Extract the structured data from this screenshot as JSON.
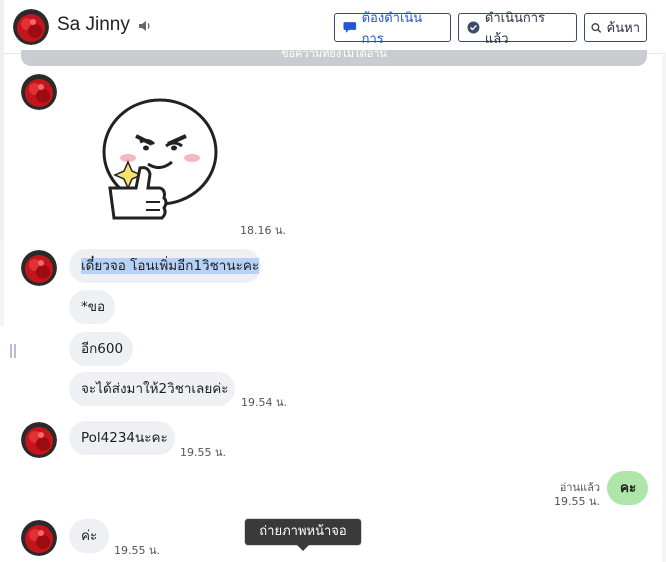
{
  "header": {
    "contact_name": "Sa Jinny",
    "buttons": {
      "todo_label": "ต้องดำเนินการ",
      "done_label": "ดำเนินการแล้ว",
      "search_label": "ค้นหา"
    }
  },
  "unread_banner": "ข้อความที่ยังไม่ได้อ่าน",
  "messages": [
    {
      "type": "sticker",
      "time": "18.16 น."
    },
    {
      "text_highlighted": "เดี๋ยวจอ โอนเพิ่มอีก1วิชานะคะ"
    },
    {
      "text": "*ขอ"
    },
    {
      "text": "อีก600"
    },
    {
      "text": "จะได้ส่งมาให้2วิชาเลยค่ะ",
      "time": "19.54 น."
    },
    {
      "text": "Pol4234นะคะ",
      "time": "19.55 น."
    },
    {
      "text": "คะ",
      "outgoing": true,
      "read_label": "อ่านแล้ว",
      "time": "19.55 น."
    },
    {
      "text": "ค่ะ",
      "time": "19.55 น."
    }
  ],
  "tooltip": "ถ่ายภาพหน้าจอ",
  "colors": {
    "incoming_bubble": "#eef0f3",
    "outgoing_bubble": "#aee5a8",
    "highlight": "#b7d2f7",
    "button_border": "#3d4a6b"
  }
}
